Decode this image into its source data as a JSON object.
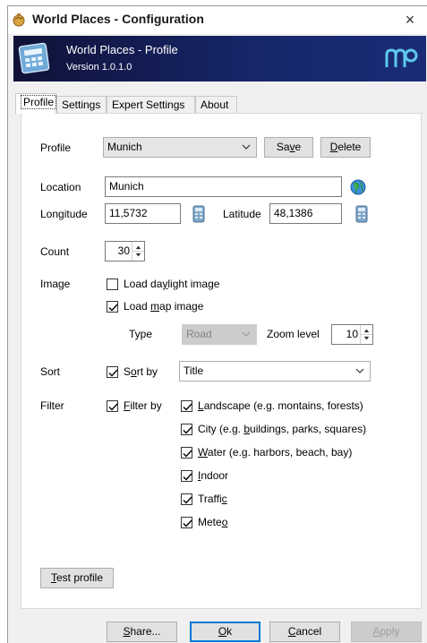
{
  "window": {
    "title": "World Places - Configuration",
    "close": "×"
  },
  "banner": {
    "title": "World Places - Profile",
    "version": "Version 1.0.1.0"
  },
  "tabs": [
    "Profile",
    "Settings",
    "Expert Settings",
    "About"
  ],
  "profile": {
    "label": "Profile",
    "value": "Munich",
    "save_pre": "Sa",
    "save_u": "v",
    "save_post": "e",
    "delete_u": "D",
    "delete_post": "elete"
  },
  "location": {
    "label": "Location",
    "value": "Munich"
  },
  "longitude": {
    "label": "Longitude",
    "value": "11,5732"
  },
  "latitude": {
    "label": "Latitude",
    "value": "48,1386"
  },
  "count": {
    "label": "Count",
    "value": "30"
  },
  "image": {
    "label": "Image",
    "daylight_pre": "Load da",
    "daylight_u": "y",
    "daylight_post": "light image",
    "daylight_checked": false,
    "map_pre": "Load ",
    "map_u": "m",
    "map_post": "ap image",
    "map_checked": true,
    "type_label": "Type",
    "type_value": "Road",
    "zoom_label": "Zoom level",
    "zoom_value": "10"
  },
  "sort": {
    "label": "Sort",
    "check_pre": "S",
    "check_u": "o",
    "check_post": "rt by",
    "checked": true,
    "value": "Title"
  },
  "filter": {
    "label": "Filter",
    "check_u": "F",
    "check_post": "ilter by",
    "checked": true,
    "items": [
      {
        "pre": "",
        "u": "L",
        "post": "andscape (e.g. montains, forests)",
        "checked": true
      },
      {
        "pre": "City (e.g. ",
        "u": "b",
        "post": "uildings, parks, squares)",
        "checked": true
      },
      {
        "pre": "",
        "u": "W",
        "post": "ater (e.g. harbors, beach, bay)",
        "checked": true
      },
      {
        "pre": "",
        "u": "I",
        "post": "ndoor",
        "checked": true
      },
      {
        "pre": "Traffi",
        "u": "c",
        "post": "",
        "checked": true
      },
      {
        "pre": "Mete",
        "u": "o",
        "post": "",
        "checked": true
      }
    ]
  },
  "test_button": {
    "u": "T",
    "post": "est profile"
  },
  "footer": {
    "share_u": "S",
    "share_post": "hare...",
    "ok_u": "O",
    "ok_post": "k",
    "cancel_u": "C",
    "cancel_post": "ancel",
    "apply_u": "A",
    "apply_post": "pply"
  },
  "colors": {
    "banner": "#17276b",
    "accent": "#0078d7",
    "disabled": "#cccccc"
  }
}
